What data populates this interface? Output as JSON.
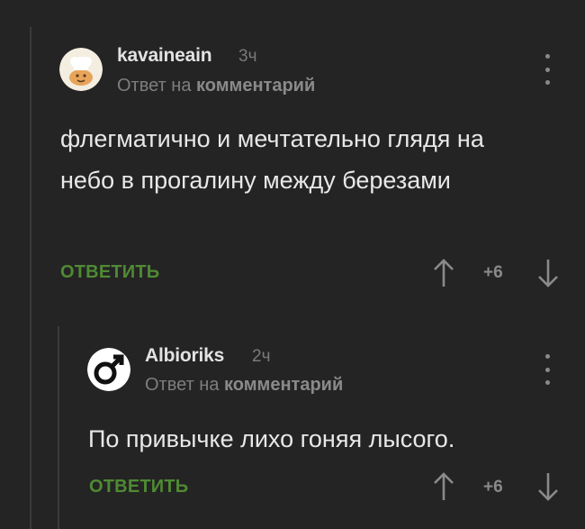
{
  "comments": [
    {
      "username": "kavaineain",
      "time": "3ч",
      "reply_prefix": "Ответ на",
      "reply_link": "комментарий",
      "text": "флегматично и мечтательно глядя на небо в прогалину между березами",
      "reply_button": "ОТВЕТИТЬ",
      "rating": "+6",
      "avatar_icon": "chef-avatar-icon"
    },
    {
      "username": "Albioriks",
      "time": "2ч",
      "reply_prefix": "Ответ на",
      "reply_link": "комментарий",
      "text": "По привычке лихо гоняя лысого.",
      "reply_button": "ОТВЕТИТЬ",
      "rating": "+6",
      "avatar_icon": "male-symbol-avatar-icon"
    }
  ],
  "colors": {
    "background": "#242424",
    "accent_green": "#4f8a33",
    "muted": "#7e7e7e",
    "text": "#e8e8e8"
  }
}
